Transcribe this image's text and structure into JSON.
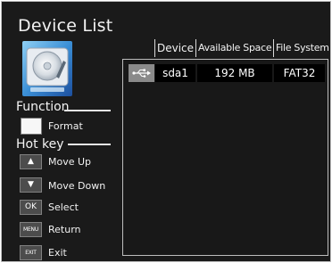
{
  "title": "Device List",
  "table": {
    "headers": [
      "Device",
      "Available Space",
      "File System"
    ],
    "rows": [
      {
        "icon": "usb-drive-icon",
        "device": "sda1",
        "space": "192 MB",
        "fs": "FAT32"
      }
    ]
  },
  "function": {
    "label": "Function",
    "items": [
      {
        "label": "Format"
      }
    ]
  },
  "hotkey": {
    "label": "Hot key",
    "items": [
      {
        "key": "▲",
        "label": "Move Up",
        "icon": "up-arrow-icon"
      },
      {
        "key": "▼",
        "label": "Move Down",
        "icon": "down-arrow-icon"
      },
      {
        "key": "OK",
        "label": "Select"
      },
      {
        "key": "MENU",
        "label": "Return"
      },
      {
        "key": "EXIT",
        "label": "Exit"
      }
    ]
  },
  "colors": {
    "background": "#1a1a1a",
    "text": "#f2f2f2",
    "border": "#bdbdbd"
  }
}
